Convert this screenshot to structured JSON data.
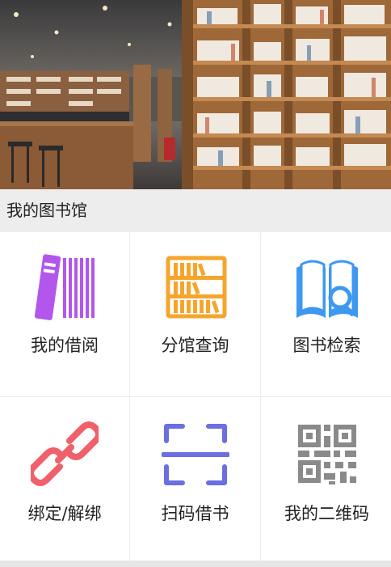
{
  "section": {
    "title": "我的图书馆"
  },
  "menu": [
    {
      "label": "我的借阅",
      "icon": "books-icon",
      "color": "#b256ec"
    },
    {
      "label": "分馆查询",
      "icon": "bookshelf-icon",
      "color": "#f6a52c"
    },
    {
      "label": "图书检索",
      "icon": "book-search-icon",
      "color": "#3e98f0"
    },
    {
      "label": "绑定/解绑",
      "icon": "chain-link-icon",
      "color": "#f0606a"
    },
    {
      "label": "扫码借书",
      "icon": "scan-icon",
      "color": "#6b6fe0"
    },
    {
      "label": "我的二维码",
      "icon": "qr-code-icon",
      "color": "#8a8a8a"
    }
  ]
}
